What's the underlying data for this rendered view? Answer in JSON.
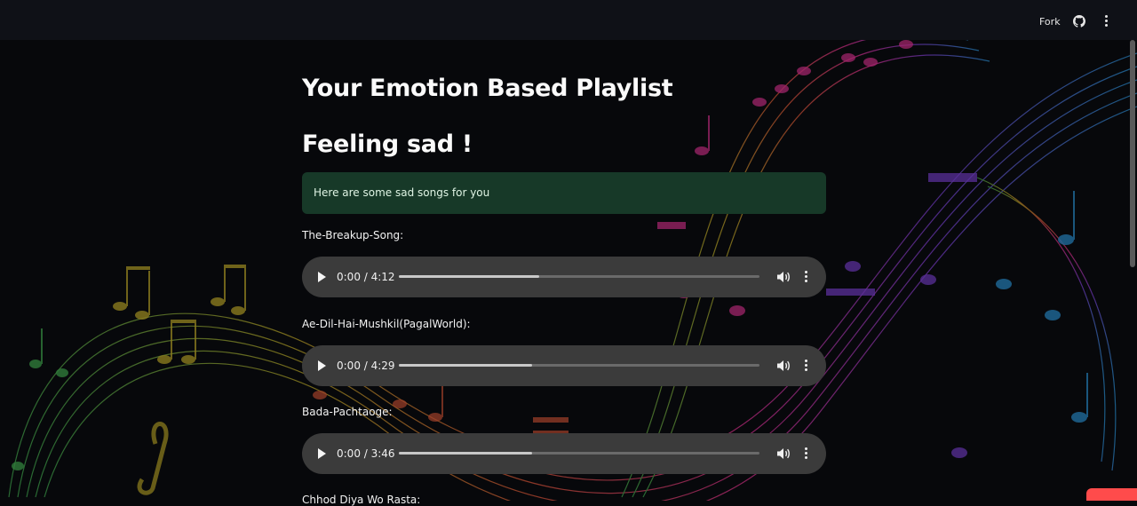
{
  "header": {
    "fork_label": "Fork"
  },
  "main": {
    "title": "Your Emotion Based Playlist",
    "emotion_heading": "Feeling sad !",
    "alert_text": "Here are some sad songs for you"
  },
  "songs": [
    {
      "label": "The-Breakup-Song:",
      "time": "0:00 / 4:12",
      "progress": 0.39
    },
    {
      "label": "Ae-Dil-Hai-Mushkil(PagalWorld):",
      "time": "0:00 / 4:29",
      "progress": 0.37
    },
    {
      "label": "Bada-Pachtaoge:",
      "time": "0:00 / 3:46",
      "progress": 0.37
    },
    {
      "label": "Chhod Diya Wo Rasta:"
    }
  ],
  "colors": {
    "background": "#07080b",
    "topbar": "#0f1117",
    "alert_bg": "#173928",
    "player_bg": "#3b3b3b",
    "accent": "#ff4b4b"
  },
  "icons": [
    "github-icon",
    "kebab-menu-icon",
    "play-icon",
    "volume-icon",
    "more-options-icon"
  ]
}
